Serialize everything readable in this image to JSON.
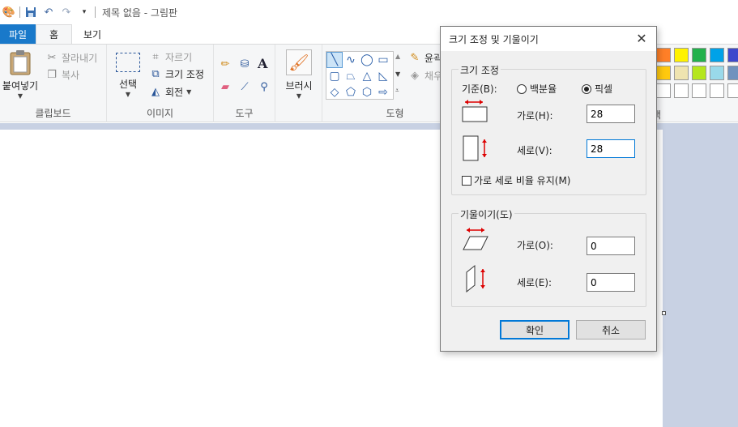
{
  "window": {
    "title": "제목 없음 - 그림판"
  },
  "tabs": {
    "file": "파일",
    "home": "홈",
    "view": "보기"
  },
  "ribbon": {
    "clipboard": {
      "label": "클립보드",
      "paste": "붙여넣기",
      "cut": "잘라내기",
      "copy": "복사"
    },
    "image": {
      "label": "이미지",
      "select": "선택",
      "crop": "자르기",
      "resize": "크기 조정",
      "rotate": "회전"
    },
    "tools": {
      "label": "도구",
      "text_icon": "A"
    },
    "brushes": {
      "label": "브러시"
    },
    "shapes": {
      "label": "도형",
      "outline": "윤곽",
      "fill": "채우"
    },
    "colors": {
      "label_fragment": "색"
    }
  },
  "dialog": {
    "title": "크기 조정 및 기울이기",
    "resize": {
      "legend": "크기 조정",
      "basis_label": "기준(B):",
      "percent_label": "백분율",
      "pixel_label": "픽셀",
      "selected": "pixel",
      "horizontal_label": "가로(H):",
      "horizontal_value": "28",
      "vertical_label": "세로(V):",
      "vertical_value": "28",
      "keep_aspect_label": "가로 세로 비율 유지(M)"
    },
    "skew": {
      "legend": "기울이기(도)",
      "horizontal_label": "가로(O):",
      "horizontal_value": "0",
      "vertical_label": "세로(E):",
      "vertical_value": "0"
    },
    "ok": "확인",
    "cancel": "취소"
  },
  "colors": {
    "accent": "#1979ca",
    "palette_row1": [
      "#ff7f27",
      "#fff200",
      "#22b14c",
      "#00a2e8",
      "#3f48cc"
    ],
    "palette_row2": [
      "#ffc90e",
      "#efe4b0",
      "#b5e61d",
      "#99d9ea",
      "#7092be"
    ],
    "palette_row3": [
      "#ffffff",
      "#ffffff",
      "#ffffff",
      "#ffffff",
      "#ffffff"
    ]
  }
}
